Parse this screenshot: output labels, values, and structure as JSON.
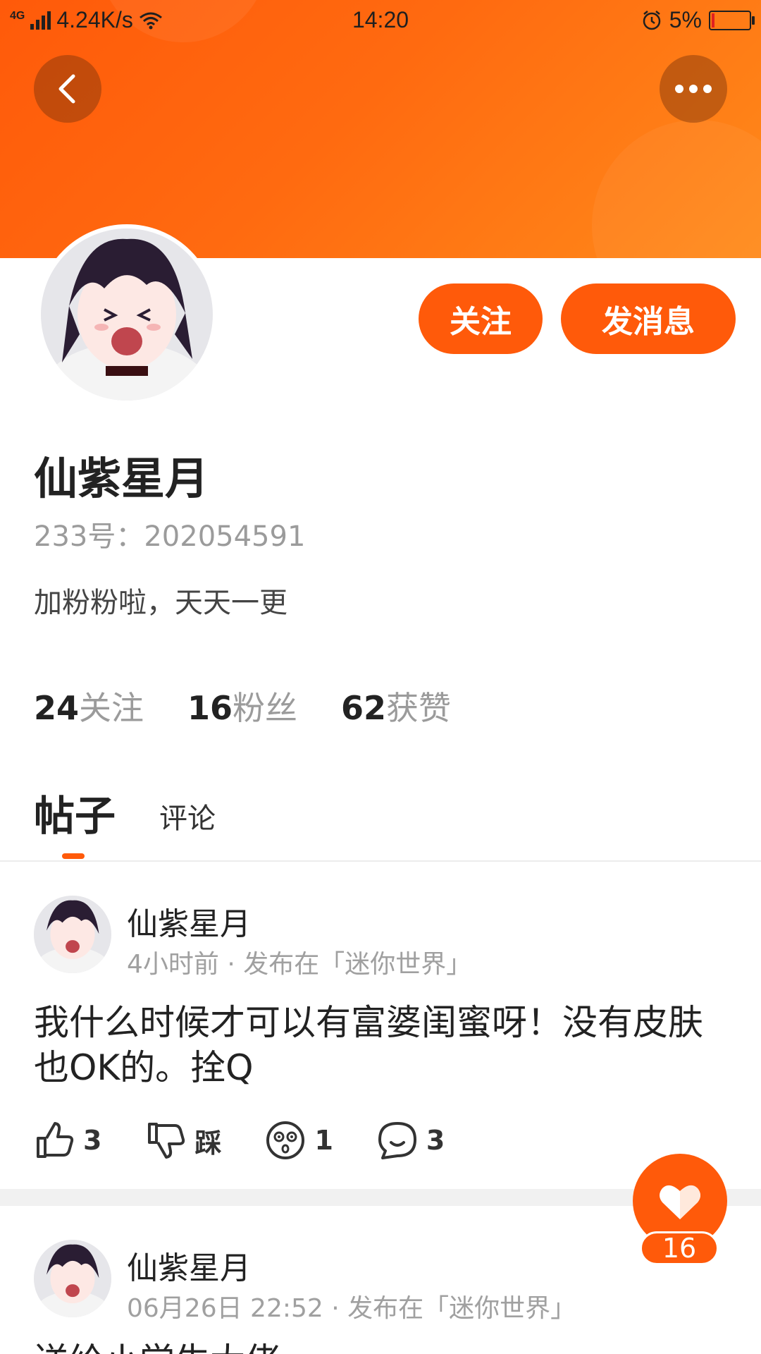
{
  "status_bar": {
    "network": "4G",
    "speed": "4.24K/s",
    "time": "14:20",
    "battery": "5%"
  },
  "header": {
    "back_icon": "chevron-left-icon",
    "more_icon": "more-dots-icon"
  },
  "profile": {
    "name": "仙紫星月",
    "id_text": "233号：202054591",
    "bio": "加粉粉啦，天天一更",
    "follow_label": "关注",
    "message_label": "发消息",
    "stats": [
      {
        "value": "24",
        "label": "关注"
      },
      {
        "value": "16",
        "label": "粉丝"
      },
      {
        "value": "62",
        "label": "获赞"
      }
    ]
  },
  "tabs": {
    "active": "帖子",
    "other": "评论"
  },
  "posts": [
    {
      "author": "仙紫星月",
      "meta": "4小时前 · 发布在「迷你世界」",
      "content": "我什么时候才可以有富婆闺蜜呀！没有皮肤也OK的。拴Q",
      "like_count": "3",
      "dislike_label": "踩",
      "dizzy_count": "1",
      "comment_count": "3"
    },
    {
      "author": "仙紫星月",
      "meta": "06月26日 22:52 · 发布在「迷你世界」",
      "content": "送给小学生大佬"
    }
  ],
  "fab": {
    "icon": "heart-icon",
    "count": "16"
  },
  "colors": {
    "accent": "#ff5a0a",
    "header_gradient_end": "#ff8a1a"
  }
}
